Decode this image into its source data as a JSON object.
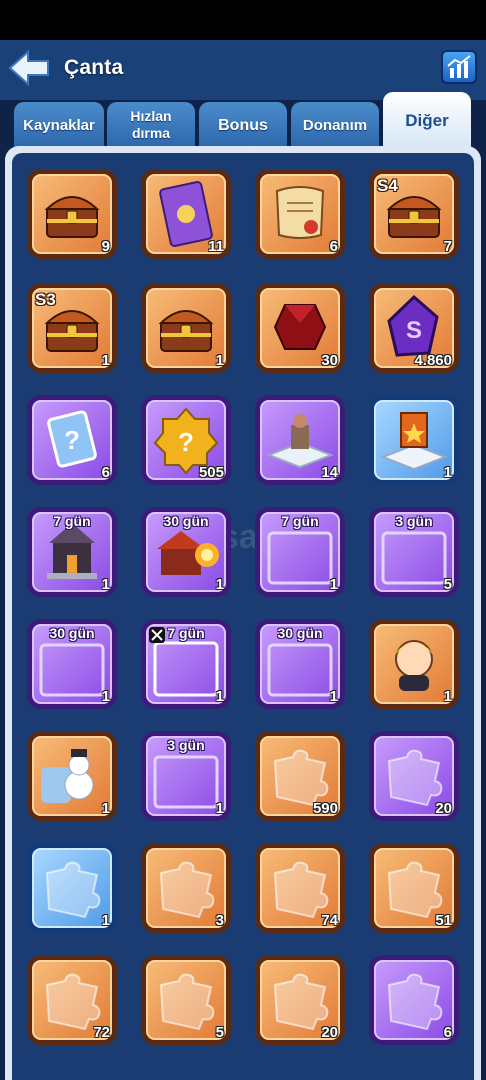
{
  "header": {
    "title": "Çanta",
    "back_icon": "back-arrow-icon",
    "stats_icon": "bar-chart-icon"
  },
  "tabs": [
    {
      "label": "Kaynaklar",
      "active": false
    },
    {
      "label_line1": "Hızlan",
      "label_line2": "dırma",
      "active": false
    },
    {
      "label": "Bonus",
      "active": false
    },
    {
      "label": "Donanım",
      "active": false
    },
    {
      "label": "Diğer",
      "active": true
    }
  ],
  "watermark": "itemsatis",
  "items": [
    {
      "name": "treasure-chest-paw",
      "icon": "chest-icon",
      "rarity": "orange",
      "count": "9"
    },
    {
      "name": "purple-card",
      "icon": "card-icon",
      "rarity": "orange",
      "count": "11"
    },
    {
      "name": "scroll",
      "icon": "scroll-icon",
      "rarity": "orange",
      "count": "6"
    },
    {
      "name": "s4-chest",
      "icon": "chest-icon",
      "rarity": "orange",
      "badge": "S4",
      "count": "7"
    },
    {
      "name": "s3-chest",
      "icon": "chest-icon",
      "rarity": "orange",
      "badge": "S3",
      "count": "1"
    },
    {
      "name": "wooden-chest",
      "icon": "chest-icon",
      "rarity": "orange",
      "count": "1"
    },
    {
      "name": "red-gem",
      "icon": "gem-icon",
      "rarity": "orange",
      "count": "30"
    },
    {
      "name": "purple-s-token",
      "icon": "token-icon",
      "rarity": "orange",
      "count": "4.860"
    },
    {
      "name": "mystery-card",
      "icon": "question-card-icon",
      "rarity": "purple",
      "count": "6"
    },
    {
      "name": "mystery-badge",
      "icon": "question-badge-icon",
      "rarity": "purple",
      "count": "505"
    },
    {
      "name": "statue-platform",
      "icon": "statue-icon",
      "rarity": "purple",
      "count": "14"
    },
    {
      "name": "banner-platform",
      "icon": "banner-icon",
      "rarity": "blue",
      "count": "1"
    },
    {
      "name": "dark-castle",
      "icon": "castle-icon",
      "rarity": "purple",
      "timer": "7 gün",
      "count": "1"
    },
    {
      "name": "fire-building",
      "icon": "building-icon",
      "rarity": "purple",
      "timer": "30 gün",
      "count": "1"
    },
    {
      "name": "plain-frame",
      "icon": "frame-icon",
      "rarity": "purple",
      "timer": "7 gün",
      "count": "1"
    },
    {
      "name": "skull-frame",
      "icon": "frame-icon",
      "rarity": "purple",
      "timer": "3 gün",
      "count": "5"
    },
    {
      "name": "flower-frame",
      "icon": "frame-icon",
      "rarity": "purple",
      "timer": "30 gün",
      "count": "1"
    },
    {
      "name": "x-frame",
      "icon": "x-logo-icon",
      "rarity": "purple",
      "timer": "7 gün",
      "count": "1"
    },
    {
      "name": "snow-frame",
      "icon": "frame-icon",
      "rarity": "purple",
      "timer": "30 gün",
      "count": "1"
    },
    {
      "name": "blonde-hero",
      "icon": "avatar-icon",
      "rarity": "orange",
      "count": "1"
    },
    {
      "name": "snowman-chair",
      "icon": "snowman-icon",
      "rarity": "orange",
      "count": "1"
    },
    {
      "name": "chocolate-frame",
      "icon": "frame-icon",
      "rarity": "purple",
      "timer": "3 gün",
      "count": "1"
    },
    {
      "name": "gold-puzzle",
      "icon": "puzzle-icon",
      "rarity": "orange",
      "count": "590"
    },
    {
      "name": "purple-puzzle",
      "icon": "puzzle-icon",
      "rarity": "purple",
      "count": "20"
    },
    {
      "name": "blue-puzzle",
      "icon": "puzzle-icon",
      "rarity": "blue",
      "count": "1"
    },
    {
      "name": "hooded-hero-puzzle",
      "icon": "puzzle-icon",
      "rarity": "orange",
      "count": "3"
    },
    {
      "name": "red-hat-hero-puzzle",
      "icon": "puzzle-icon",
      "rarity": "orange",
      "count": "74"
    },
    {
      "name": "old-hero-puzzle",
      "icon": "puzzle-icon",
      "rarity": "orange",
      "count": "51"
    },
    {
      "name": "goggle-hero-puzzle",
      "icon": "puzzle-icon",
      "rarity": "orange",
      "count": "72"
    },
    {
      "name": "blonde-hero-puzzle",
      "icon": "puzzle-icon",
      "rarity": "orange",
      "count": "5"
    },
    {
      "name": "white-hair-hero-puzzle",
      "icon": "puzzle-icon",
      "rarity": "orange",
      "count": "20"
    },
    {
      "name": "doctor-hero-puzzle",
      "icon": "puzzle-icon",
      "rarity": "purple",
      "count": "6"
    }
  ]
}
